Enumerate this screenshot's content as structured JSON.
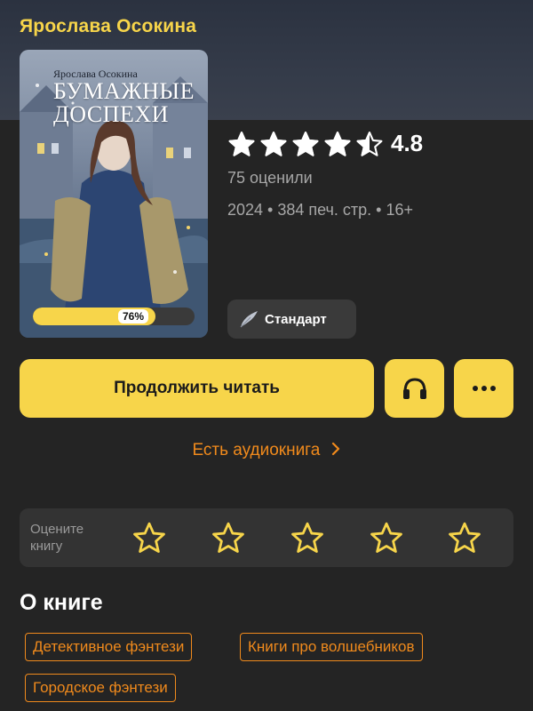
{
  "author": "Ярослава Осокина",
  "cover": {
    "author": "Ярослава Осокина",
    "title": "БУМАЖНЫЕ ДОСПЕХИ"
  },
  "progress": {
    "percent": 76,
    "label": "76%"
  },
  "rating": {
    "value": "4.8",
    "stars_filled": 4.5
  },
  "ratings_count": "75 оценили",
  "meta": "2024 • 384 печ. стр. • 16+",
  "badge": {
    "label": "Стандарт",
    "icon": "feather-icon"
  },
  "actions": {
    "continue_label": "Продолжить читать",
    "listen_icon": "headphones-icon",
    "more_icon": "more-dots-icon"
  },
  "audio_link": "Есть аудиокнига",
  "rate_panel": {
    "label": "Оцените книгу",
    "stars": 5
  },
  "about": {
    "title": "О книге",
    "tags": [
      "Детективное фэнтези",
      "Книги про волшебников",
      "Городское фэнтези"
    ]
  },
  "colors": {
    "accent_yellow": "#f7d54a",
    "accent_orange": "#f08a1c",
    "background": "#242424"
  }
}
